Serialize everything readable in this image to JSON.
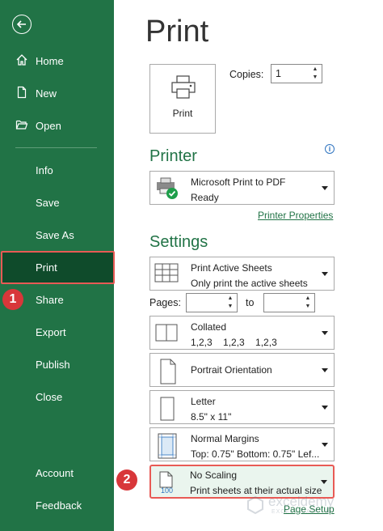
{
  "sidebar": {
    "items": [
      {
        "label": "Home",
        "icon": "home-icon"
      },
      {
        "label": "New",
        "icon": "new-file-icon"
      },
      {
        "label": "Open",
        "icon": "folder-open-icon"
      },
      {
        "label": "Info"
      },
      {
        "label": "Save"
      },
      {
        "label": "Save As"
      },
      {
        "label": "Print",
        "active": true
      },
      {
        "label": "Share"
      },
      {
        "label": "Export"
      },
      {
        "label": "Publish"
      },
      {
        "label": "Close"
      },
      {
        "label": "Account"
      },
      {
        "label": "Feedback"
      }
    ]
  },
  "callouts": [
    "1",
    "2"
  ],
  "main": {
    "title": "Print",
    "print_button": "Print",
    "copies_label": "Copies:",
    "copies_value": "1",
    "printer_heading": "Printer",
    "printer": {
      "name": "Microsoft Print to PDF",
      "status": "Ready"
    },
    "printer_properties": "Printer Properties",
    "settings_heading": "Settings",
    "settings": [
      {
        "line1": "Print Active Sheets",
        "line2": "Only print the active sheets"
      },
      {
        "line1": "Collated",
        "line2": "1,2,3    1,2,3    1,2,3"
      },
      {
        "line1": "Portrait Orientation",
        "line2": ""
      },
      {
        "line1": "Letter",
        "line2": "8.5\" x 11\""
      },
      {
        "line1": "Normal Margins",
        "line2": "Top: 0.75\" Bottom: 0.75\" Lef..."
      },
      {
        "line1": "No Scaling",
        "line2": "Print sheets at their actual size",
        "thumb_text": "100"
      }
    ],
    "pages_label": "Pages:",
    "to_label": "to",
    "page_setup": "Page Setup"
  },
  "watermark": {
    "name": "exceldemy",
    "tagline": "EXCEL · DATA · BI"
  },
  "colors": {
    "accent": "#217346",
    "active_nav": "#0f4b2b",
    "callout": "#d8373a"
  }
}
